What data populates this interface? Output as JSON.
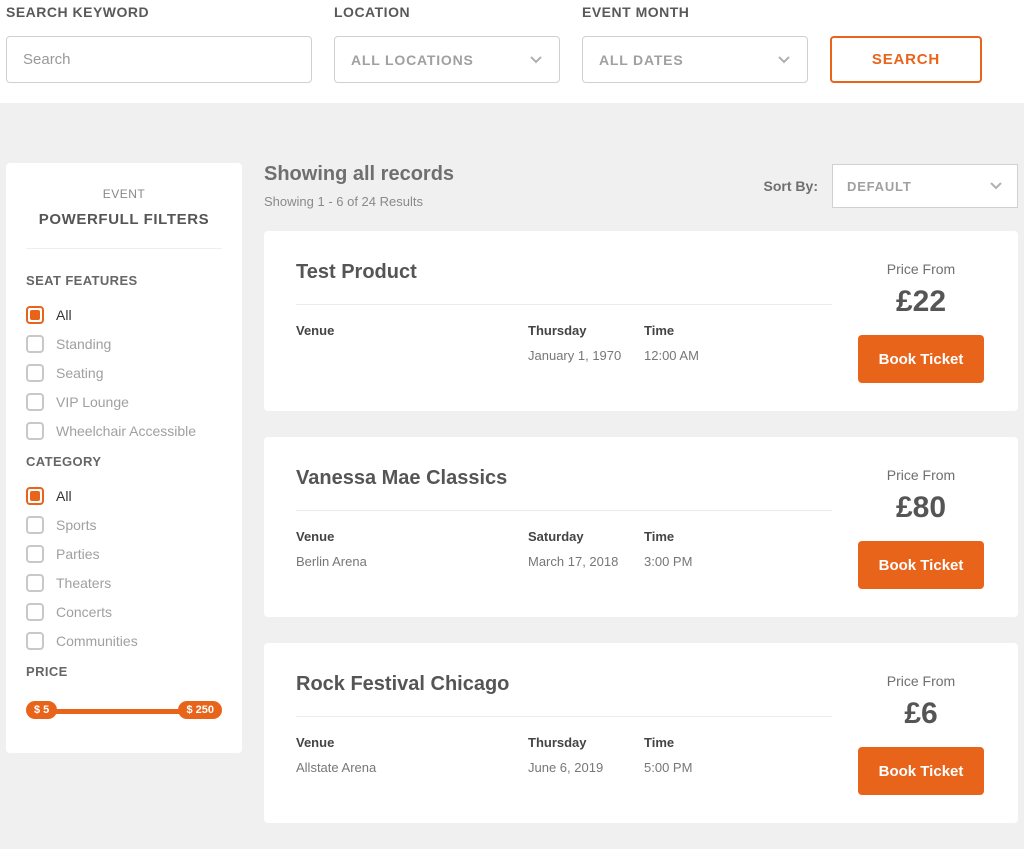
{
  "searchBar": {
    "keywordLabel": "SEARCH KEYWORD",
    "keywordPlaceholder": "Search",
    "locationLabel": "LOCATION",
    "locationValue": "ALL LOCATIONS",
    "monthLabel": "EVENT MONTH",
    "monthValue": "ALL DATES",
    "searchButton": "SEARCH"
  },
  "sidebar": {
    "eyebrow": "EVENT",
    "title": "POWERFULL FILTERS",
    "seatFeaturesTitle": "SEAT FEATURES",
    "seatFeatures": [
      {
        "label": "All",
        "checked": true
      },
      {
        "label": "Standing",
        "checked": false
      },
      {
        "label": "Seating",
        "checked": false
      },
      {
        "label": "VIP Lounge",
        "checked": false
      },
      {
        "label": "Wheelchair Accessible",
        "checked": false
      }
    ],
    "categoryTitle": "CATEGORY",
    "categories": [
      {
        "label": "All",
        "checked": true
      },
      {
        "label": "Sports",
        "checked": false
      },
      {
        "label": "Parties",
        "checked": false
      },
      {
        "label": "Theaters",
        "checked": false
      },
      {
        "label": "Concerts",
        "checked": false
      },
      {
        "label": "Communities",
        "checked": false
      }
    ],
    "priceTitle": "PRICE",
    "priceMin": "$ 5",
    "priceMax": "$ 250"
  },
  "results": {
    "heading": "Showing all records",
    "subtext": "Showing 1 - 6 of 24 Results",
    "sortLabel": "Sort By:",
    "sortValue": "DEFAULT",
    "venueHeader": "Venue",
    "timeHeader": "Time",
    "priceFromLabel": "Price From",
    "bookLabel": "Book Ticket",
    "events": [
      {
        "title": "Test Product",
        "venue": "",
        "day": "Thursday",
        "date": "January 1, 1970",
        "time": "12:00 AM",
        "price": "£22"
      },
      {
        "title": "Vanessa Mae Classics",
        "venue": "Berlin Arena",
        "day": "Saturday",
        "date": "March 17, 2018",
        "time": "3:00 PM",
        "price": "£80"
      },
      {
        "title": "Rock Festival Chicago",
        "venue": "Allstate Arena",
        "day": "Thursday",
        "date": "June 6, 2019",
        "time": "5:00 PM",
        "price": "£6"
      }
    ]
  }
}
